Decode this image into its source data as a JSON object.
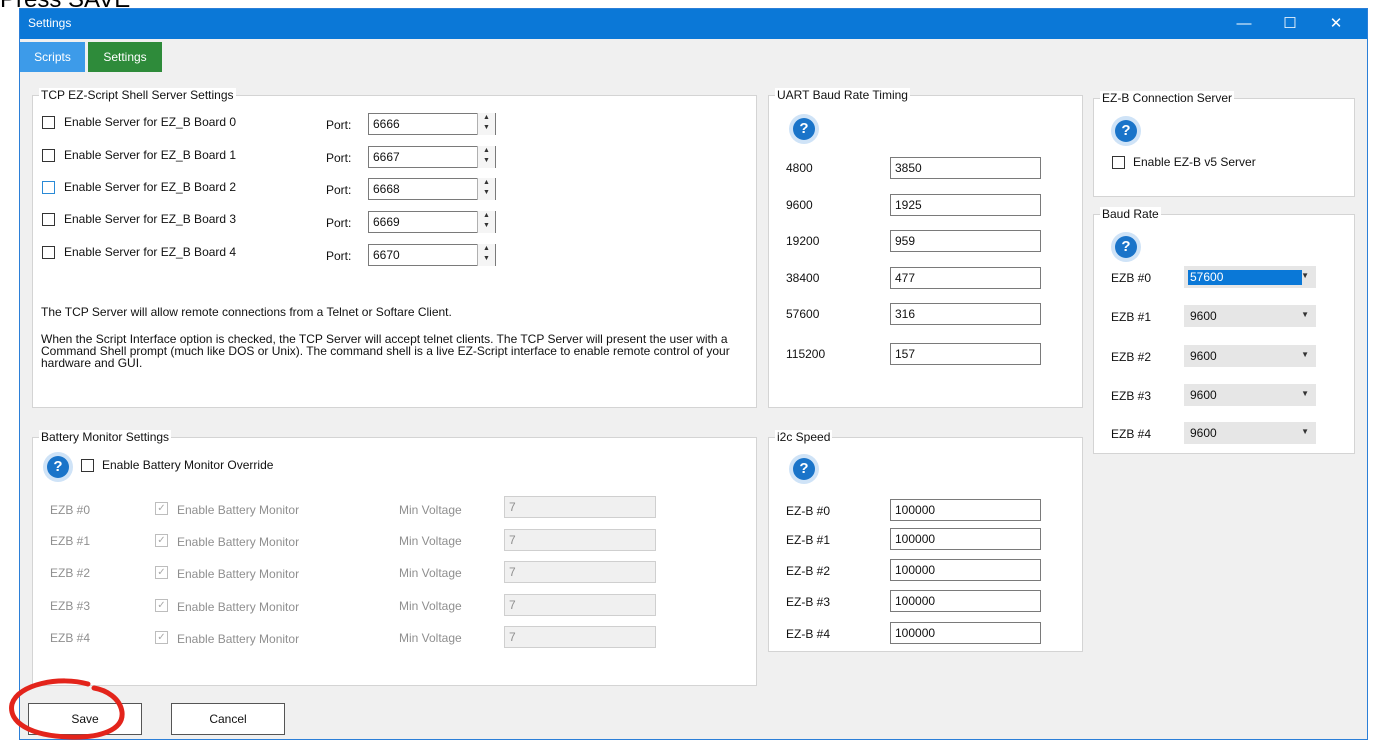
{
  "banner": "Press SAVE",
  "window": {
    "title": "Settings",
    "minimize": "—",
    "maximize": "☐",
    "close": "✕"
  },
  "tabs": [
    {
      "label": "Scripts",
      "color": "#3d9be9"
    },
    {
      "label": "Settings",
      "color": "#2e8b3a"
    }
  ],
  "tcp": {
    "title": "TCP EZ-Script Shell Server Settings",
    "port_label": "Port:",
    "boards": [
      {
        "label": "Enable Server for EZ_B Board 0",
        "port": "6666",
        "checked": false
      },
      {
        "label": "Enable Server for EZ_B Board 1",
        "port": "6667",
        "checked": false
      },
      {
        "label": "Enable Server for EZ_B Board 2",
        "port": "6668",
        "checked": false
      },
      {
        "label": "Enable Server for EZ_B Board 3",
        "port": "6669",
        "checked": false
      },
      {
        "label": "Enable Server for EZ_B Board 4",
        "port": "6670",
        "checked": false
      }
    ],
    "desc1": "The TCP Server will allow remote connections from a Telnet or Softare Client.",
    "desc2": "When the Script Interface option is checked, the TCP Server will accept telnet clients. The TCP Server will present the user with a Command Shell prompt (much like DOS or Unix). The command shell is a live EZ-Script interface to enable remote control of your hardware and GUI."
  },
  "uart": {
    "title": "UART Baud Rate Timing",
    "rows": [
      {
        "label": "4800",
        "value": "3850"
      },
      {
        "label": "9600",
        "value": "1925"
      },
      {
        "label": "19200",
        "value": "959"
      },
      {
        "label": "38400",
        "value": "477"
      },
      {
        "label": "57600",
        "value": "316"
      },
      {
        "label": "115200",
        "value": "157"
      }
    ]
  },
  "ezb_server": {
    "title": "EZ-B Connection Server",
    "checkbox": "Enable EZ-B v5 Server"
  },
  "baud": {
    "title": "Baud Rate",
    "rows": [
      {
        "label": "EZB #0",
        "value": "57600"
      },
      {
        "label": "EZB #1",
        "value": "9600"
      },
      {
        "label": "EZB #2",
        "value": "9600"
      },
      {
        "label": "EZB #3",
        "value": "9600"
      },
      {
        "label": "EZB #4",
        "value": "9600"
      }
    ]
  },
  "battery": {
    "title": "Battery Monitor Settings",
    "override": "Enable Battery Monitor Override",
    "enable_label": "Enable Battery Monitor",
    "min_label": "Min Voltage",
    "rows": [
      {
        "label": "EZB #0",
        "value": "7"
      },
      {
        "label": "EZB #1",
        "value": "7"
      },
      {
        "label": "EZB #2",
        "value": "7"
      },
      {
        "label": "EZB #3",
        "value": "7"
      },
      {
        "label": "EZB #4",
        "value": "7"
      }
    ]
  },
  "i2c": {
    "title": "i2c Speed",
    "rows": [
      {
        "label": "EZ-B #0",
        "value": "100000"
      },
      {
        "label": "EZ-B #1",
        "value": "100000"
      },
      {
        "label": "EZ-B #2",
        "value": "100000"
      },
      {
        "label": "EZ-B #3",
        "value": "100000"
      },
      {
        "label": "EZ-B #4",
        "value": "100000"
      }
    ]
  },
  "buttons": {
    "save": "Save",
    "cancel": "Cancel"
  },
  "colors": {
    "titlebar": "#0b78d7",
    "annotation": "#e3241b"
  }
}
